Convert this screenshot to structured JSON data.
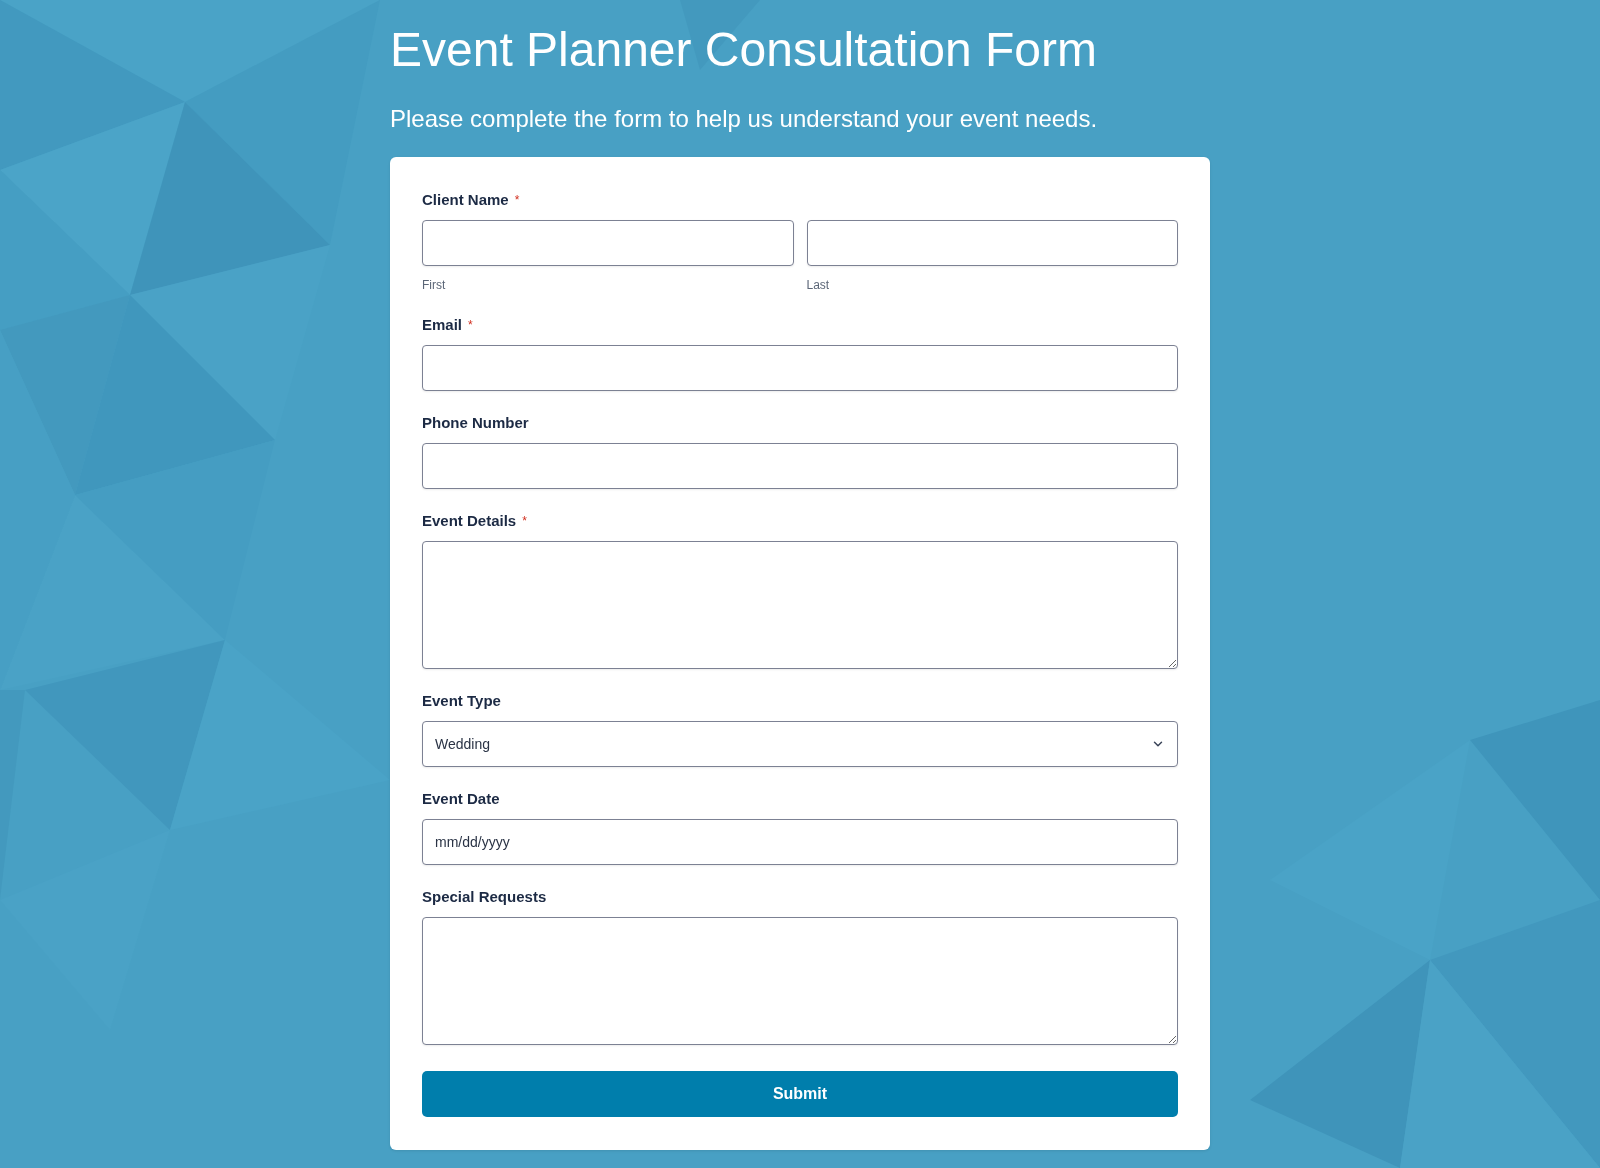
{
  "title": "Event Planner Consultation Form",
  "subtitle": "Please complete the form to help us understand your event needs.",
  "required_mark": "*",
  "fields": [
    {
      "kind": "name",
      "label": "Client Name",
      "required": true,
      "parts": [
        {
          "sublabel": "First"
        },
        {
          "sublabel": "Last"
        }
      ]
    },
    {
      "kind": "text",
      "label": "Email",
      "required": true
    },
    {
      "kind": "text",
      "label": "Phone Number",
      "required": false
    },
    {
      "kind": "textarea",
      "label": "Event Details",
      "required": true
    },
    {
      "kind": "select",
      "label": "Event Type",
      "required": false,
      "value": "Wedding"
    },
    {
      "kind": "date",
      "label": "Event Date",
      "required": false,
      "placeholder": "mm/dd/yyyy"
    },
    {
      "kind": "textarea",
      "label": "Special Requests",
      "required": false
    }
  ],
  "submit": {
    "label": "Submit"
  }
}
